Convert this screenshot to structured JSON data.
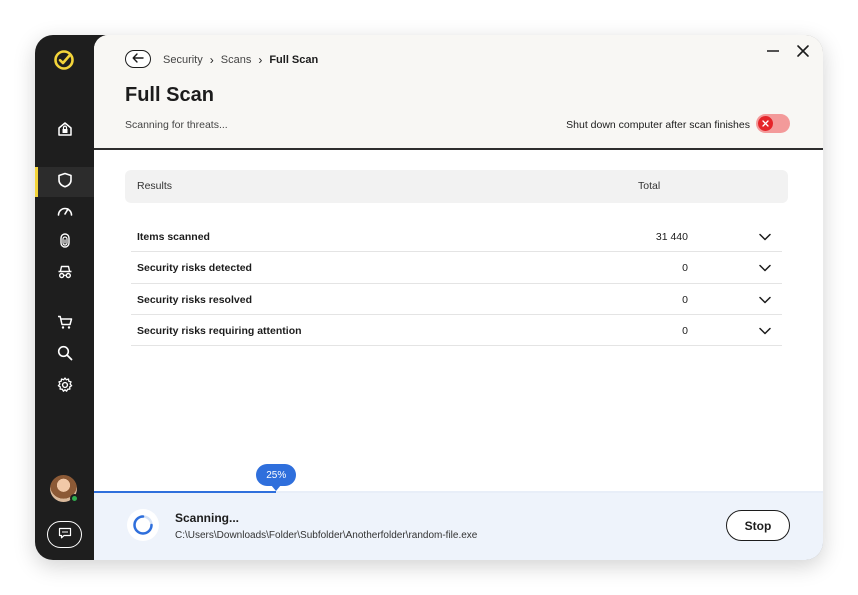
{
  "sidebar": {
    "logo": "norton-check-logo",
    "items": [
      {
        "name": "sidebar-item-home",
        "icon": "house-lock-icon",
        "active": false
      },
      {
        "name": "sidebar-item-security",
        "icon": "shield-icon",
        "active": true
      },
      {
        "name": "sidebar-item-performance",
        "icon": "speedometer-icon",
        "active": false
      },
      {
        "name": "sidebar-item-identity",
        "icon": "fingerprint-icon",
        "active": false
      },
      {
        "name": "sidebar-item-privacy",
        "icon": "incognito-icon",
        "active": false
      },
      {
        "name": "sidebar-item-shopping",
        "icon": "cart-icon",
        "active": false
      },
      {
        "name": "sidebar-item-search",
        "icon": "search-icon",
        "active": false
      },
      {
        "name": "sidebar-item-settings",
        "icon": "gear-icon",
        "active": false
      }
    ],
    "accent": "#f3d43a"
  },
  "breadcrumb": {
    "items": [
      "Security",
      "Scans"
    ],
    "current": "Full Scan"
  },
  "page": {
    "title": "Full Scan",
    "subtitle": "Scanning for threats..."
  },
  "shutdown": {
    "label": "Shut down computer after scan finishes",
    "enabled": false
  },
  "results": {
    "header_results": "Results",
    "header_total": "Total",
    "rows": [
      {
        "label": "Items scanned",
        "value": "31 440"
      },
      {
        "label": "Security risks detected",
        "value": "0"
      },
      {
        "label": "Security risks resolved",
        "value": "0"
      },
      {
        "label": "Security risks requiring attention",
        "value": "0"
      }
    ]
  },
  "progress": {
    "percent": 25,
    "label": "25%",
    "color": "#2f6fdc"
  },
  "scan": {
    "status": "Scanning...",
    "path": "C:\\Users\\Downloads\\Folder\\Subfolder\\Anotherfolder\\random-file.exe",
    "stop_label": "Stop"
  }
}
